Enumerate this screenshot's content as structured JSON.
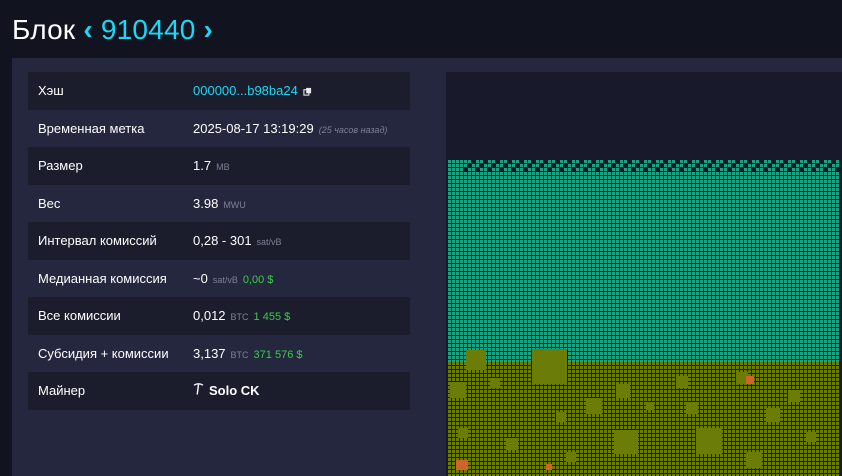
{
  "header": {
    "title_word": "Блок",
    "prev_icon": "chevron-left-icon",
    "block_height": "910440",
    "next_icon": "chevron-right-icon"
  },
  "details": {
    "hash": {
      "label": "Хэш",
      "value": "000000...b98ba24",
      "icon": "copy-icon"
    },
    "timestamp": {
      "label": "Временная метка",
      "value": "2025-08-17 13:19:29",
      "relative": "(25 часов назад)"
    },
    "size": {
      "label": "Размер",
      "value": "1.7",
      "unit": "MB"
    },
    "weight": {
      "label": "Вес",
      "value": "3.98",
      "unit": "MWU"
    },
    "fee_span": {
      "label": "Интервал комиссий",
      "value": "0,28 - 301",
      "unit": "sat/vB"
    },
    "median_fee": {
      "label": "Медианная комиссия",
      "value": "~0",
      "unit": "sat/vB",
      "usd": "0,00 $"
    },
    "total_fees": {
      "label": "Все комиссии",
      "value": "0,012",
      "unit": "BTC",
      "usd": "1 455 $"
    },
    "subsidy_fees": {
      "label": "Субсидия + комиссии",
      "value": "3,137",
      "unit": "BTC",
      "usd": "371 576 $"
    },
    "miner": {
      "label": "Майнер",
      "value": "Solo CK",
      "icon": "pickaxe-icon"
    }
  },
  "colors": {
    "accent": "#1bd8f4",
    "usd": "#3bcc49",
    "low_fee_tx": "#19a383",
    "mid_fee_tx": "#6c7c09",
    "high_fee_tx": "#d0622c"
  }
}
